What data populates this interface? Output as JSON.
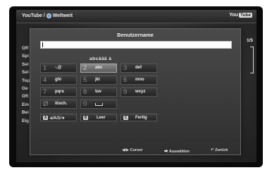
{
  "breadcrumb": {
    "app": "YouTube /",
    "section": "Weltweit"
  },
  "logo": {
    "you": "You",
    "tube": "Tube"
  },
  "background_list": [
    "Off",
    "Spi",
    "Sel",
    "Sel",
    "Top",
    "Ge",
    "Oft",
    "Em",
    "Bei",
    "Eig"
  ],
  "pager": "1/5",
  "dialog": {
    "title": "Benutzername",
    "input_value": "",
    "mode_label": "abcäää à",
    "keys": [
      {
        "num": "1",
        "label": "-.@",
        "selected": false
      },
      {
        "num": "2",
        "label": "abc",
        "selected": true
      },
      {
        "num": "3",
        "label": "def",
        "selected": false
      },
      {
        "num": "4",
        "label": "ghi",
        "selected": false
      },
      {
        "num": "5",
        "label": "jkl",
        "selected": false
      },
      {
        "num": "6",
        "label": "mno",
        "selected": false
      },
      {
        "num": "7",
        "label": "pqrs",
        "selected": false
      },
      {
        "num": "8",
        "label": "tuv",
        "selected": false
      },
      {
        "num": "9",
        "label": "wxyz",
        "selected": false
      },
      {
        "num": "Ø",
        "label": "lösch.",
        "selected": false
      },
      {
        "num": "0",
        "label": "space-icon",
        "selected": false
      }
    ],
    "function_keys": [
      {
        "badge": "A",
        "label": "a/A/1/★"
      },
      {
        "badge": "B",
        "label": "Leer"
      },
      {
        "badge": "C",
        "label": "Fertig"
      }
    ]
  },
  "footer": {
    "cursor": "◀/▶ Cursor",
    "select": "Auswählen",
    "back": "Zurück"
  }
}
